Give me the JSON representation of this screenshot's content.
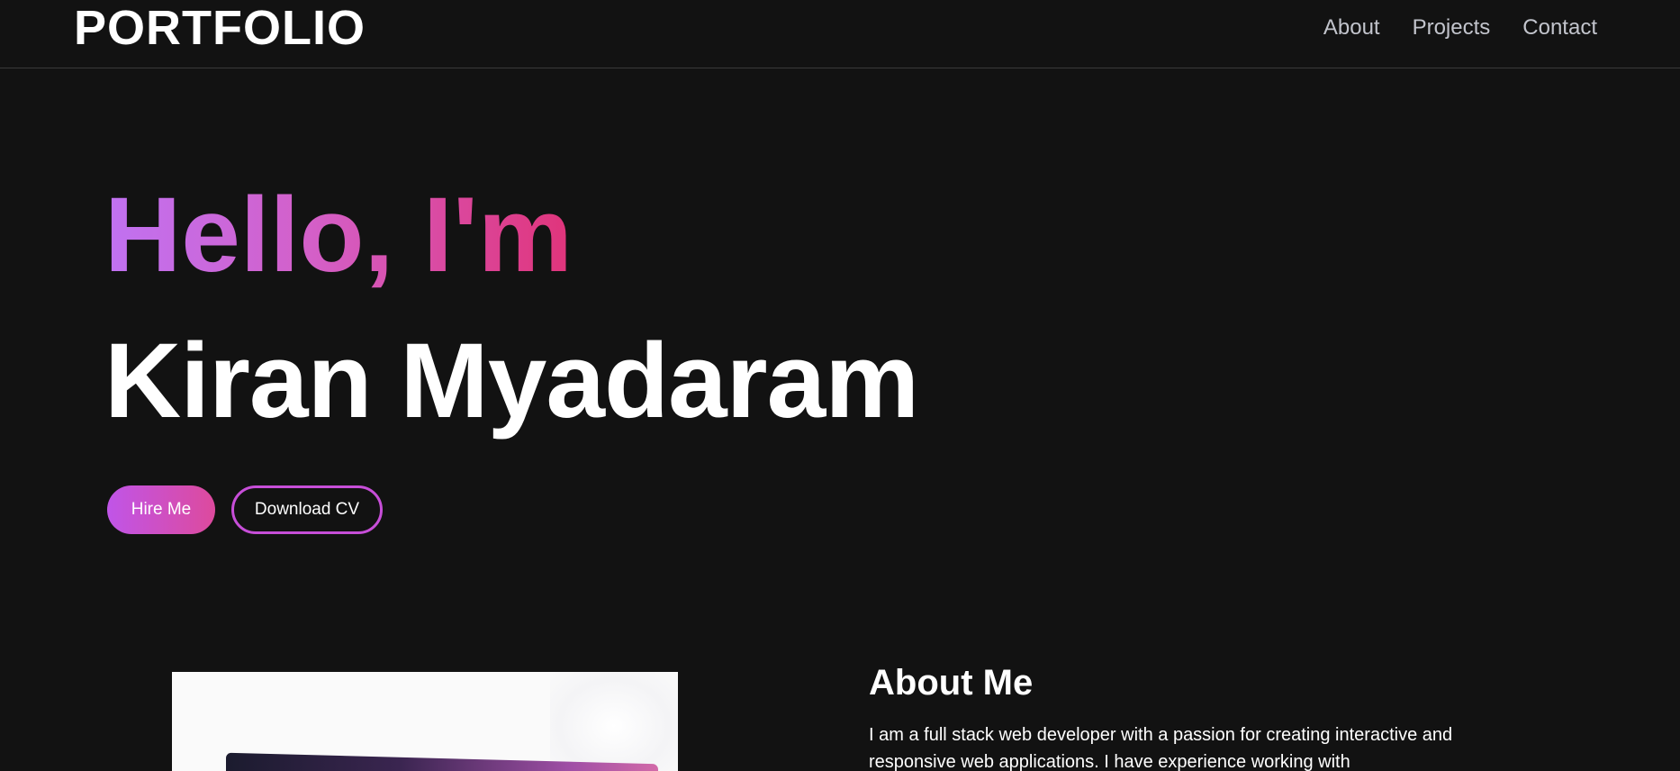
{
  "header": {
    "logo": "PORTFOLIO",
    "nav": [
      {
        "label": "About"
      },
      {
        "label": "Projects"
      },
      {
        "label": "Contact"
      }
    ]
  },
  "hero": {
    "greeting": "Hello, I'm",
    "name": "Kiran Myadaram",
    "hire_label": "Hire Me",
    "cv_label": "Download CV"
  },
  "about": {
    "title": "About Me",
    "text": "I am a full stack web developer with a passion for creating interactive and responsive web applications. I have experience working with"
  },
  "colors": {
    "background": "#121212",
    "accent_start": "#c072f2",
    "accent_end": "#e0347a",
    "nav_text": "#c2c4cc"
  }
}
